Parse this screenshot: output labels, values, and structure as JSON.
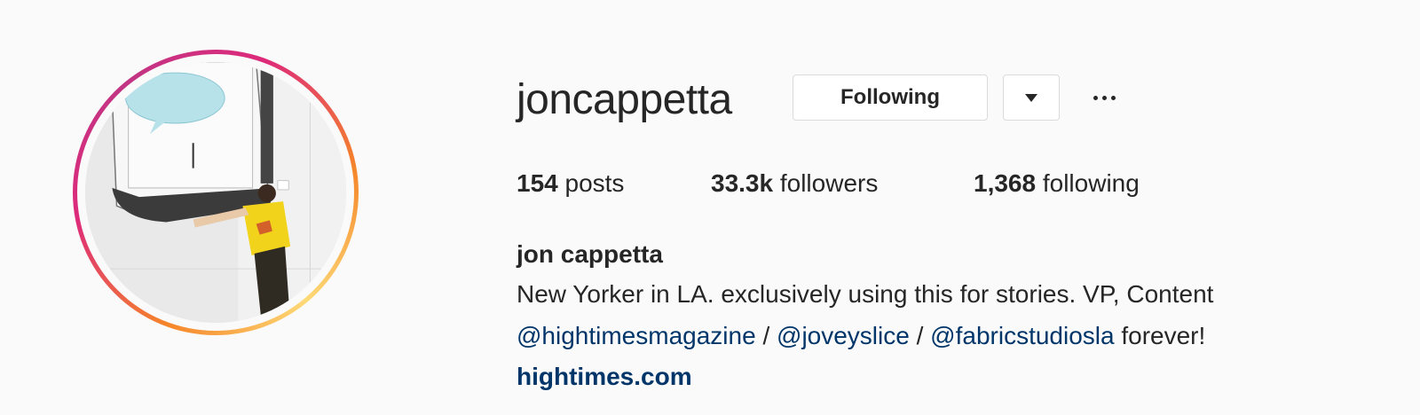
{
  "profile": {
    "username": "joncappetta",
    "following_button_label": "Following",
    "full_name": "jon cappetta",
    "website": "hightimes.com"
  },
  "stats": {
    "posts_count": "154",
    "posts_label": "posts",
    "followers_count": "33.3k",
    "followers_label": "followers",
    "following_count": "1,368",
    "following_label": "following"
  },
  "bio": {
    "line1": "New Yorker in LA. exclusively using this for stories. VP, Content",
    "mention1": "@hightimesmagazine",
    "sep1": " / ",
    "mention2": "@joveyslice",
    "sep2": " / ",
    "mention3": "@fabricstudiosla",
    "tail": " forever!"
  },
  "icons": {
    "dropdown": "chevron-down-icon",
    "more": "more-options-icon"
  },
  "colors": {
    "link": "#003569",
    "text": "#262626",
    "ring_start": "#f58529",
    "ring_end": "#c13584"
  }
}
